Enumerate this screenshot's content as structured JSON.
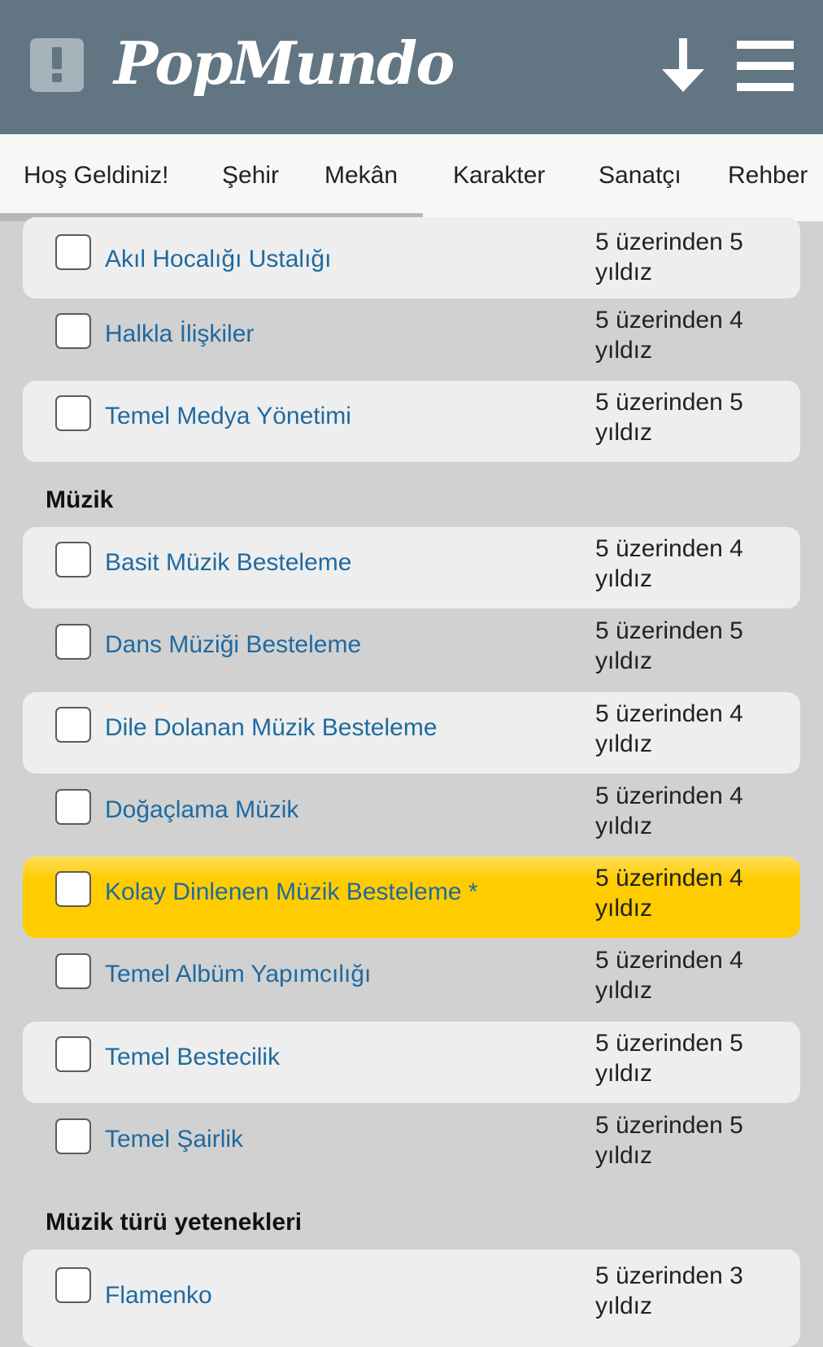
{
  "header": {
    "logo_text": "PopMundo",
    "alert_icon": "exclamation-icon",
    "download_icon": "download-arrow-icon",
    "menu_icon": "hamburger-icon",
    "background": "#627582"
  },
  "tabs": [
    "Hoş Geldiniz!",
    "Şehir",
    "Mekân",
    "Karakter",
    "Sanatçı",
    "Rehber"
  ],
  "skills_top": [
    {
      "name": "Akıl Hocalığı Ustalığı",
      "rating": "5 üzerinden 5 yıldız"
    },
    {
      "name": "Halkla İlişkiler",
      "rating": "5 üzerinden 4 yıldız"
    },
    {
      "name": "Temel Medya Yönetimi",
      "rating": "5 üzerinden 5 yıldız"
    }
  ],
  "section_music": {
    "title": "Müzik",
    "items": [
      {
        "name": "Basit Müzik Besteleme",
        "rating": "5 üzerinden 4 yıldız"
      },
      {
        "name": "Dans Müziği Besteleme",
        "rating": "5 üzerinden 5 yıldız"
      },
      {
        "name": "Dile Dolanan Müzik Besteleme",
        "rating": "5 üzerinden 4 yıldız"
      },
      {
        "name": "Doğaçlama Müzik",
        "rating": "5 üzerinden 4 yıldız"
      },
      {
        "name": "Kolay Dinlenen Müzik Besteleme *",
        "rating": "5 üzerinden 4 yıldız"
      },
      {
        "name": "Temel Albüm Yapımcılığı",
        "rating": "5 üzerinden 4 yıldız"
      },
      {
        "name": "Temel Bestecilik",
        "rating": "5 üzerinden 5 yıldız"
      },
      {
        "name": "Temel Şairlik",
        "rating": "5 üzerinden 5 yıldız"
      }
    ]
  },
  "section_genre": {
    "title": "Müzik türü yetenekleri",
    "items": [
      {
        "name": "Flamenko",
        "rating": "5 üzerinden 3 yıldız"
      }
    ]
  },
  "colors": {
    "link": "#1f6aa0",
    "highlight": "#ffcc00",
    "row_light": "#eeeeee",
    "row_dark": "#d1d1d1"
  }
}
